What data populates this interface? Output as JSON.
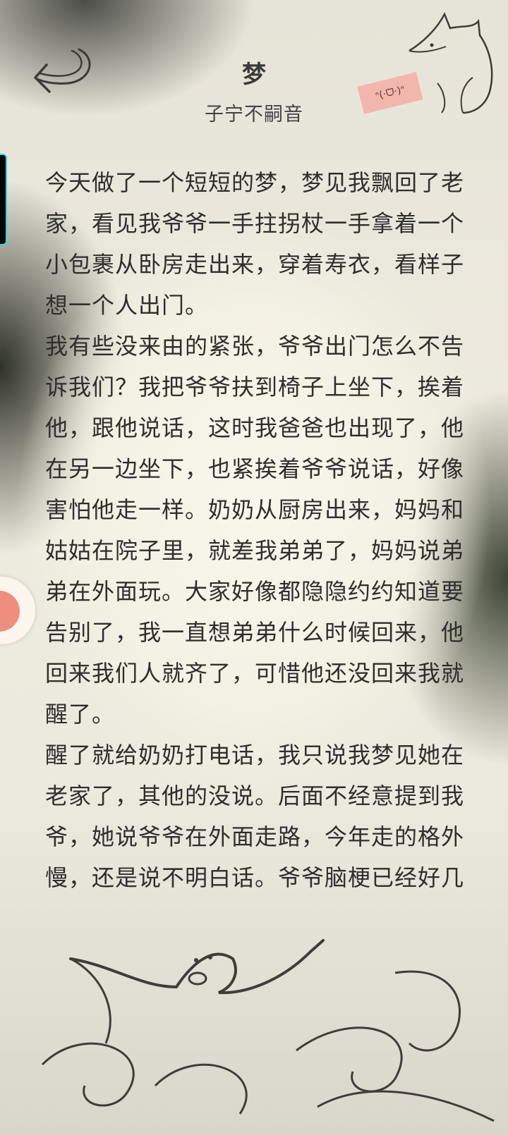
{
  "header": {
    "title": "梦",
    "author": "子宁不嗣音",
    "tag_text": "ᐢ(·ᗜ·)ᐢ"
  },
  "icons": {
    "back": "back-arrow-icon",
    "fox": "fox-illustration-icon",
    "seal": "seal-wave-illustration-icon",
    "float": "floating-assistant-icon"
  },
  "content": {
    "paragraphs": [
      "今天做了一个短短的梦，梦见我飘回了老家，看见我爷爷一手拄拐杖一手拿着一个小包裹从卧房走出来，穿着寿衣，看样子想一个人出门。",
      "我有些没来由的紧张，爷爷出门怎么不告诉我们？我把爷爷扶到椅子上坐下，挨着他，跟他说话，这时我爸爸也出现了，他在另一边坐下，也紧挨着爷爷说话，好像害怕他走一样。奶奶从厨房出来，妈妈和姑姑在院子里，就差我弟弟了，妈妈说弟弟在外面玩。大家好像都隐隐约约知道要告别了，我一直想弟弟什么时候回来，他回来我们人就齐了，可惜他还没回来我就醒了。",
      "醒了就给奶奶打电话，我只说我梦见她在老家了，其他的没说。后面不经意提到我爷，她说爷爷在外面走路，今年走的格外慢，还是说不明白话。爷爷脑梗已经好几年，半边身子瘫了，后面站起"
    ]
  },
  "colors": {
    "text": "#2e2e2c",
    "tag": "#f2b6ac",
    "edge_tab_border": "#2fd8e6",
    "float_ball": "#ee8e7e"
  }
}
